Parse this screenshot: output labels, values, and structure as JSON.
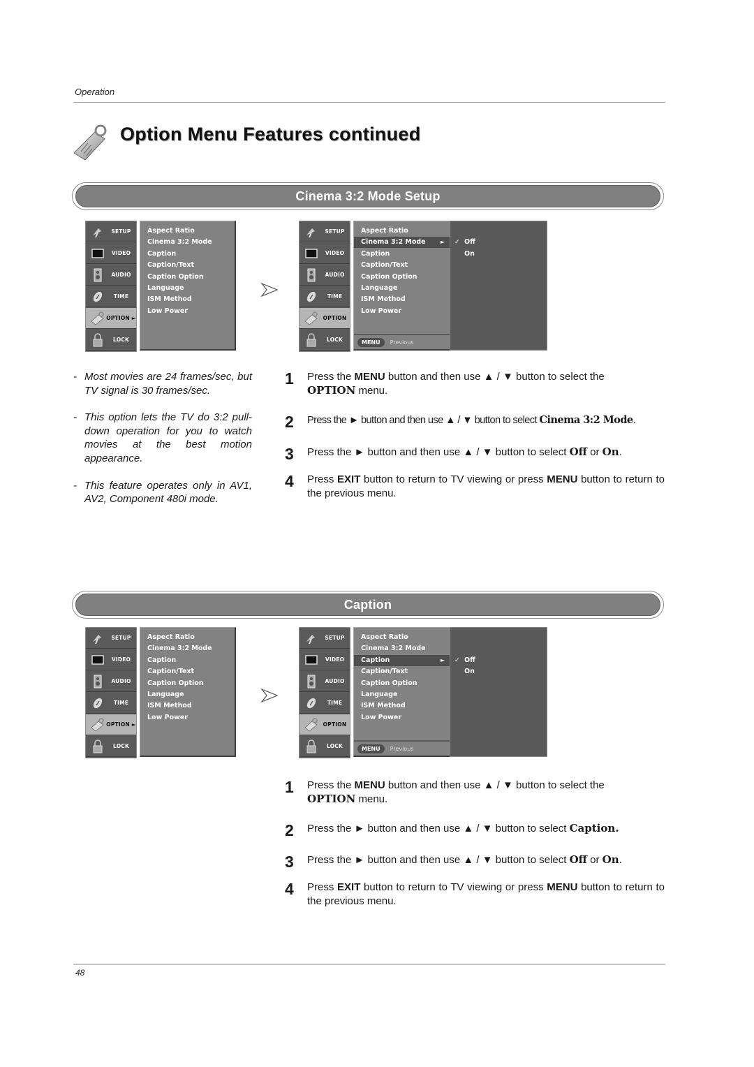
{
  "header": {
    "section_label": "Operation"
  },
  "page_title": "Option Menu Features continued",
  "sections": [
    {
      "title": "Cinema 3:2 Mode Setup",
      "menu_before": {
        "side_items": [
          "SETUP",
          "VIDEO",
          "AUDIO",
          "TIME",
          "OPTION ►",
          "LOCK"
        ],
        "active_side": "OPTION",
        "main_items": [
          "Aspect Ratio",
          "Cinema 3:2 Mode",
          "Caption",
          "Caption/Text",
          "Caption Option",
          "Language",
          "ISM Method",
          "Low Power"
        ]
      },
      "menu_after": {
        "side_items": [
          "SETUP",
          "VIDEO",
          "AUDIO",
          "TIME",
          "OPTION",
          "LOCK"
        ],
        "main_items": [
          "Aspect Ratio",
          "Cinema 3:2 Mode",
          "Caption",
          "Caption/Text",
          "Caption Option",
          "Language",
          "ISM Method",
          "Low Power"
        ],
        "selected_item": "Cinema 3:2 Mode",
        "selected_arrow": "►",
        "sub_options": [
          "Off",
          "On"
        ],
        "checked_option": "Off",
        "check_mark": "✓",
        "footer_menu": "MENU",
        "footer_previous": "Previous"
      },
      "notes": [
        "Most movies are 24 frames/sec, but TV signal is 30 frames/sec.",
        "This option lets the TV do 3:2 pull-down operation for you to watch movies at the best motion appearance.",
        "This feature operates only in AV1, AV2, Component 480i mode."
      ],
      "steps": [
        {
          "num": "1",
          "parts": [
            "Press the ",
            "MENU",
            " button and then use ▲ / ▼  button to select the ",
            "OPTION",
            " menu."
          ]
        },
        {
          "num": "2",
          "parts": [
            "Press the ► button and then use ▲ / ▼ button to select ",
            "Cinema 3:2 Mode",
            "."
          ]
        },
        {
          "num": "3",
          "parts": [
            "Press the ►  button and then use ▲ / ▼ button to select ",
            "Off",
            " or ",
            "On",
            "."
          ]
        },
        {
          "num": "4",
          "parts": [
            "Press ",
            "EXIT",
            " button to return to TV viewing or press ",
            "MENU",
            " button to return to the previous menu."
          ]
        }
      ]
    },
    {
      "title": "Caption",
      "menu_before": {
        "side_items": [
          "SETUP",
          "VIDEO",
          "AUDIO",
          "TIME",
          "OPTION ►",
          "LOCK"
        ],
        "active_side": "OPTION",
        "main_items": [
          "Aspect Ratio",
          "Cinema 3:2 Mode",
          "Caption",
          "Caption/Text",
          "Caption Option",
          "Language",
          "ISM Method",
          "Low Power"
        ]
      },
      "menu_after": {
        "side_items": [
          "SETUP",
          "VIDEO",
          "AUDIO",
          "TIME",
          "OPTION",
          "LOCK"
        ],
        "main_items": [
          "Aspect Ratio",
          "Cinema 3:2 Mode",
          "Caption",
          "Caption/Text",
          "Caption Option",
          "Language",
          "ISM Method",
          "Low Power"
        ],
        "selected_item": "Caption",
        "selected_arrow": "►",
        "sub_options": [
          "Off",
          "On"
        ],
        "checked_option": "Off",
        "check_mark": "✓",
        "footer_menu": "MENU",
        "footer_previous": "Previous"
      },
      "steps": [
        {
          "num": "1",
          "parts": [
            "Press the ",
            "MENU",
            " button and then use ▲ / ▼  button to select the ",
            "OPTION",
            " menu."
          ]
        },
        {
          "num": "2",
          "parts": [
            "Press the ►  button and then use ▲ / ▼ button to select ",
            "Caption."
          ]
        },
        {
          "num": "3",
          "parts": [
            "Press the ►  button and then use ▲ / ▼ button to select ",
            "Off",
            " or ",
            "On",
            "."
          ]
        },
        {
          "num": "4",
          "parts": [
            "Press ",
            "EXIT",
            " button to return to TV viewing or press ",
            "MENU",
            " button to return to the previous menu."
          ]
        }
      ]
    }
  ],
  "icons": {
    "title": "option-tag-icon",
    "side": [
      "satellite-dish-icon",
      "screen-icon",
      "speaker-icon",
      "clock-icon",
      "option-tag-icon",
      "padlock-icon"
    ],
    "transition": "next-arrow-icon"
  },
  "colors": {
    "section_bar": "#808080",
    "osd_side": "#5a5a5a",
    "osd_main": "#828282",
    "osd_selected": "#4e4e4e",
    "osd_sub": "#595959",
    "osd_active_side": "#b5b5b5"
  },
  "footer": {
    "page_number": "48"
  }
}
